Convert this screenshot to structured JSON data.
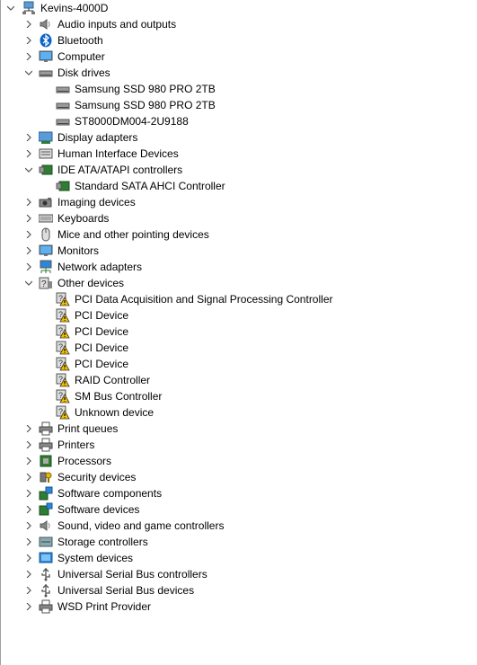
{
  "tree": {
    "root": {
      "label": "Kevins-4000D",
      "icon": "computer-network-icon",
      "expanded": true
    },
    "audio": {
      "label": "Audio inputs and outputs",
      "icon": "speaker-icon"
    },
    "bluetooth": {
      "label": "Bluetooth",
      "icon": "bluetooth-icon"
    },
    "computer": {
      "label": "Computer",
      "icon": "monitor-icon"
    },
    "disk_drives": {
      "label": "Disk drives",
      "icon": "disk-drive-icon",
      "expanded": true,
      "children": [
        "Samsung SSD 980 PRO 2TB",
        "Samsung SSD 980 PRO 2TB",
        "ST8000DM004-2U9188"
      ]
    },
    "display": {
      "label": "Display adapters",
      "icon": "display-adapter-icon"
    },
    "hid": {
      "label": "Human Interface Devices",
      "icon": "hid-icon"
    },
    "ide": {
      "label": "IDE ATA/ATAPI controllers",
      "icon": "ide-controller-icon",
      "expanded": true,
      "children": [
        "Standard SATA AHCI Controller"
      ]
    },
    "imaging": {
      "label": "Imaging devices",
      "icon": "camera-icon"
    },
    "keyboards": {
      "label": "Keyboards",
      "icon": "keyboard-icon"
    },
    "mice": {
      "label": "Mice and other pointing devices",
      "icon": "mouse-icon"
    },
    "monitors": {
      "label": "Monitors",
      "icon": "monitor-icon"
    },
    "network": {
      "label": "Network adapters",
      "icon": "network-adapter-icon"
    },
    "other": {
      "label": "Other devices",
      "icon": "unknown-device-icon",
      "expanded": true,
      "children": [
        "PCI Data Acquisition and Signal Processing Controller",
        "PCI Device",
        "PCI Device",
        "PCI Device",
        "PCI Device",
        "RAID Controller",
        "SM Bus Controller",
        "Unknown device"
      ]
    },
    "print_queues": {
      "label": "Print queues",
      "icon": "printer-icon"
    },
    "printers": {
      "label": "Printers",
      "icon": "printer-icon"
    },
    "processors": {
      "label": "Processors",
      "icon": "processor-icon"
    },
    "security": {
      "label": "Security devices",
      "icon": "security-key-icon"
    },
    "software_components": {
      "label": "Software components",
      "icon": "software-component-icon"
    },
    "software_devices": {
      "label": "Software devices",
      "icon": "software-device-icon"
    },
    "sound": {
      "label": "Sound, video and game controllers",
      "icon": "speaker-icon"
    },
    "storage": {
      "label": "Storage controllers",
      "icon": "storage-controller-icon"
    },
    "system": {
      "label": "System devices",
      "icon": "system-device-icon"
    },
    "usb_controllers": {
      "label": "Universal Serial Bus controllers",
      "icon": "usb-icon"
    },
    "usb_devices": {
      "label": "Universal Serial Bus devices",
      "icon": "usb-icon"
    },
    "wsd": {
      "label": "WSD Print Provider",
      "icon": "printer-icon"
    }
  },
  "colors": {
    "warning": "#f5c400",
    "accent": "#0078d7",
    "arrow": "#555555"
  }
}
